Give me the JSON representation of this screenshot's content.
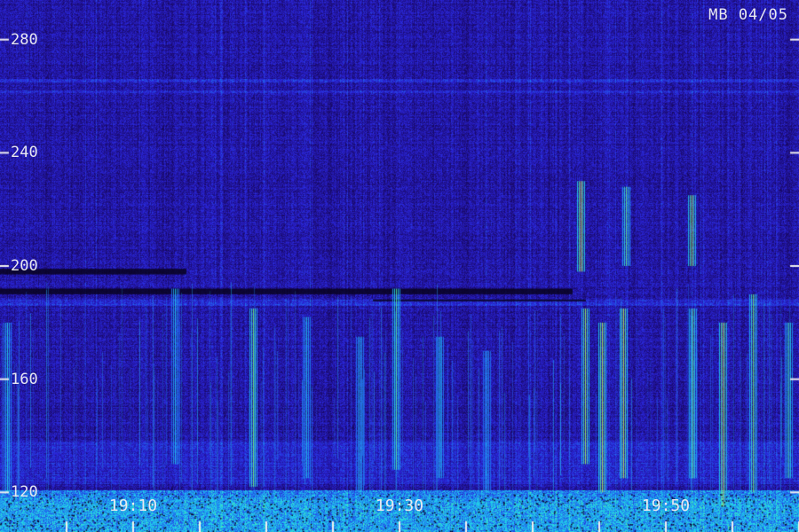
{
  "chart_data": {
    "type": "heatmap",
    "title": "MB 04/05",
    "xlabel": "",
    "ylabel": "",
    "y_tick_labels": [
      "280",
      "240",
      "200",
      "160",
      "120"
    ],
    "y_ticks": [
      280,
      240,
      200,
      160,
      120
    ],
    "ylim": [
      106,
      294
    ],
    "x_tick_labels": [
      "19:10",
      "19:30",
      "19:50"
    ],
    "x_label_minutes": [
      10,
      30,
      50
    ],
    "x_tick_minutes": [
      5,
      10,
      15,
      20,
      25,
      30,
      35,
      40,
      45,
      50,
      55,
      60
    ],
    "xlim_minutes": [
      0,
      60
    ],
    "colormap": [
      "#0a0326",
      "#1a0a6e",
      "#2a24d8",
      "#1e7cf0",
      "#22d8e8",
      "#6cf07a",
      "#e8f040"
    ],
    "features": [
      {
        "kind": "dark_band",
        "freq_from": 197,
        "freq_to": 199,
        "minutes_from": 0,
        "minutes_to": 14
      },
      {
        "kind": "dark_band",
        "freq_from": 190,
        "freq_to": 192,
        "minutes_from": 0,
        "minutes_to": 43
      },
      {
        "kind": "bright_band",
        "freq_from": 186,
        "freq_to": 188,
        "minutes_from": 0,
        "minutes_to": 60
      },
      {
        "kind": "dark_line",
        "freq_from": 187.5,
        "freq_to": 188.2,
        "minutes_from": 28,
        "minutes_to": 44
      },
      {
        "kind": "bright_band",
        "freq_from": 265,
        "freq_to": 266,
        "minutes_from": 0,
        "minutes_to": 60
      },
      {
        "kind": "bright_band",
        "freq_from": 261,
        "freq_to": 262,
        "minutes_from": 0,
        "minutes_to": 60
      },
      {
        "kind": "bright_band",
        "freq_from": 123,
        "freq_to": 138,
        "minutes_from": 0,
        "minutes_to": 60
      },
      {
        "kind": "bright_band",
        "freq_from": 106,
        "freq_to": 118,
        "minutes_from": 0,
        "minutes_to": 60
      }
    ],
    "bursts": [
      {
        "minute": 0.5,
        "freq_from": 120,
        "freq_to": 180,
        "intensity": 0.5
      },
      {
        "minute": 13.1,
        "freq_from": 130,
        "freq_to": 192,
        "intensity": 0.45
      },
      {
        "minute": 19.0,
        "freq_from": 122,
        "freq_to": 185,
        "intensity": 0.75
      },
      {
        "minute": 23.0,
        "freq_from": 125,
        "freq_to": 182,
        "intensity": 0.45
      },
      {
        "minute": 27.0,
        "freq_from": 120,
        "freq_to": 175,
        "intensity": 0.45
      },
      {
        "minute": 29.7,
        "freq_from": 128,
        "freq_to": 192,
        "intensity": 0.65
      },
      {
        "minute": 33.0,
        "freq_from": 125,
        "freq_to": 175,
        "intensity": 0.45
      },
      {
        "minute": 36.5,
        "freq_from": 120,
        "freq_to": 170,
        "intensity": 0.4
      },
      {
        "minute": 43.6,
        "freq_from": 198,
        "freq_to": 230,
        "intensity": 0.95
      },
      {
        "minute": 43.9,
        "freq_from": 130,
        "freq_to": 185,
        "intensity": 0.85
      },
      {
        "minute": 45.2,
        "freq_from": 120,
        "freq_to": 180,
        "intensity": 0.9
      },
      {
        "minute": 46.8,
        "freq_from": 125,
        "freq_to": 185,
        "intensity": 0.9
      },
      {
        "minute": 47.0,
        "freq_from": 200,
        "freq_to": 228,
        "intensity": 0.7
      },
      {
        "minute": 51.9,
        "freq_from": 200,
        "freq_to": 225,
        "intensity": 0.85
      },
      {
        "minute": 52.0,
        "freq_from": 125,
        "freq_to": 185,
        "intensity": 0.7
      },
      {
        "minute": 54.3,
        "freq_from": 115,
        "freq_to": 180,
        "intensity": 0.9
      },
      {
        "minute": 56.5,
        "freq_from": 120,
        "freq_to": 190,
        "intensity": 0.75
      },
      {
        "minute": 59.2,
        "freq_from": 125,
        "freq_to": 180,
        "intensity": 0.6
      }
    ]
  }
}
